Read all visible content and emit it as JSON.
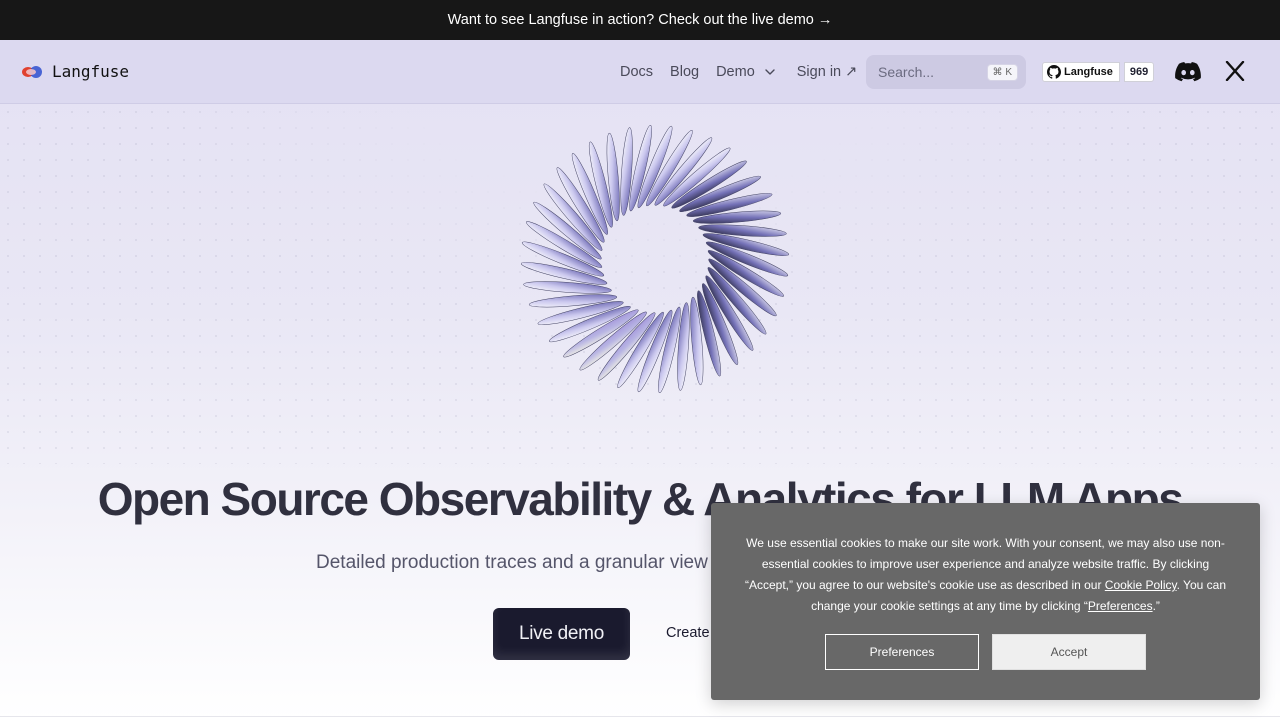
{
  "announcement": {
    "text": "Want to see Langfuse in action? Check out the live demo →"
  },
  "logo": {
    "text": "Langfuse"
  },
  "nav": {
    "docs": "Docs",
    "blog": "Blog",
    "demo": "Demo",
    "signin": "Sign in ↗"
  },
  "search": {
    "placeholder": "Search...",
    "shortcut": "⌘ K"
  },
  "github": {
    "label": "Langfuse",
    "stars": "969"
  },
  "hero": {
    "title": "Open Source Observability & Analytics for LLM Apps",
    "subtitle": "Detailed production traces and a granular view on quality, cost and latency",
    "live_demo": "Live demo",
    "create": "Create an account"
  },
  "cookie": {
    "text_1": "We use essential cookies to make our site work. With your consent, we may also use non-essential cookies to improve user experience and analyze website traffic. By clicking “Accept,” you agree to our website's cookie use as described in our ",
    "policy_link": "Cookie Policy",
    "text_2": ". You can change your cookie settings at any time by clicking “",
    "preferences_link": "Preferences",
    "text_3": ".”",
    "preferences_button": "Preferences",
    "accept_button": "Accept"
  },
  "icons": {
    "github": "github-icon",
    "discord": "discord-icon",
    "x": "x-icon",
    "chevron": "chevron-down-icon"
  },
  "colors": {
    "announcement_bg": "#171717",
    "nav_bg": "#dcd9f0",
    "primary_button": "#1a1a2e",
    "cookie_bg": "#686868"
  }
}
